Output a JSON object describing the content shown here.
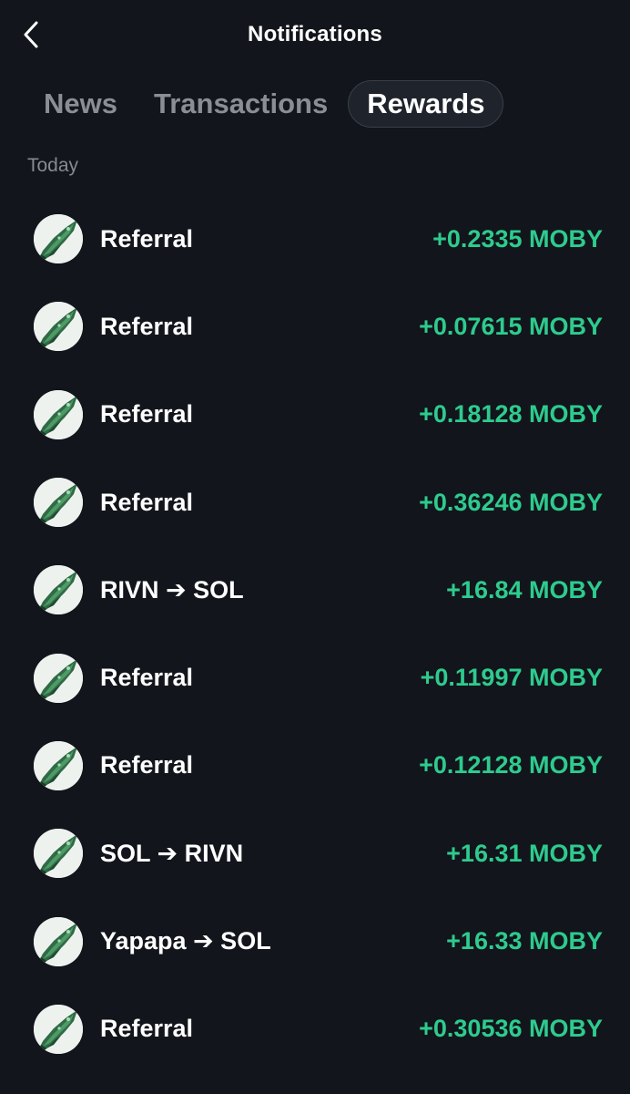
{
  "header": {
    "title": "Notifications",
    "back_icon": "chevron-left-icon"
  },
  "tabs": [
    {
      "label": "News",
      "active": false
    },
    {
      "label": "Transactions",
      "active": false
    },
    {
      "label": "Rewards",
      "active": true
    }
  ],
  "section": {
    "label": "Today"
  },
  "colors": {
    "background": "#12151b",
    "positive_amount": "#2ecb8e",
    "tab_inactive": "#8b8e94"
  },
  "rewards": [
    {
      "title": "Referral",
      "amount": "+0.2335 MOBY"
    },
    {
      "title": "Referral",
      "amount": "+0.07615 MOBY"
    },
    {
      "title": "Referral",
      "amount": "+0.18128 MOBY"
    },
    {
      "title": "Referral",
      "amount": "+0.36246 MOBY"
    },
    {
      "title": "RIVN ➔ SOL",
      "amount": "+16.84 MOBY"
    },
    {
      "title": "Referral",
      "amount": "+0.11997 MOBY"
    },
    {
      "title": "Referral",
      "amount": "+0.12128 MOBY"
    },
    {
      "title": "SOL ➔ RIVN",
      "amount": "+16.31 MOBY"
    },
    {
      "title": "Yapapa ➔ SOL",
      "amount": "+16.33 MOBY"
    },
    {
      "title": "Referral",
      "amount": "+0.30536 MOBY"
    }
  ]
}
